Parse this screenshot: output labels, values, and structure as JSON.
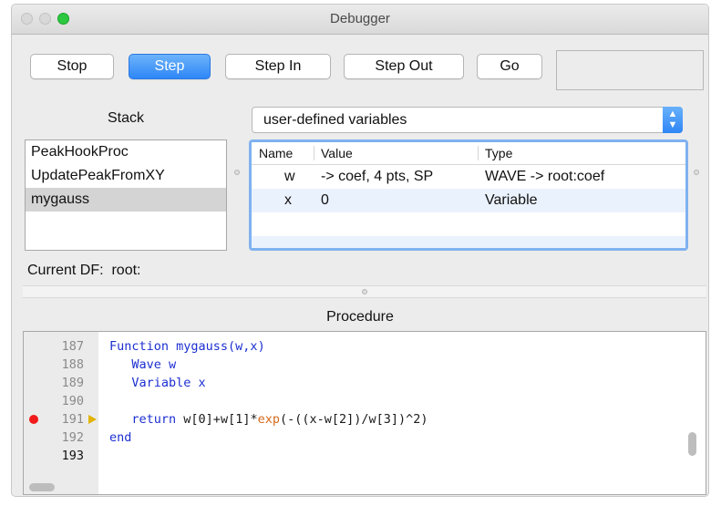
{
  "window": {
    "title": "Debugger"
  },
  "toolbar": {
    "stop_label": "Stop",
    "step_label": "Step",
    "step_in_label": "Step In",
    "step_out_label": "Step Out",
    "go_label": "Go"
  },
  "stack": {
    "label": "Stack",
    "items": [
      "PeakHookProc",
      "UpdatePeakFromXY",
      "mygauss"
    ],
    "selected": "mygauss"
  },
  "variables": {
    "dropdown_value": "user-defined variables",
    "columns": [
      "Name",
      "Value",
      "Type"
    ],
    "rows": [
      {
        "name": "w",
        "value": "-> coef, 4 pts, SP",
        "type": "WAVE -> root:coef"
      },
      {
        "name": "x",
        "value": "0",
        "type": "Variable"
      }
    ]
  },
  "current_df": {
    "label": "Current DF:",
    "value": "root:"
  },
  "procedure": {
    "label": "Procedure",
    "lines": [
      {
        "num": "187",
        "parts": [
          {
            "t": "Function",
            "c": "kw"
          },
          {
            "t": " mygauss(w,x)",
            "c": "kw"
          }
        ]
      },
      {
        "num": "188",
        "parts": [
          {
            "t": "   Wave w",
            "c": "kw"
          }
        ]
      },
      {
        "num": "189",
        "parts": [
          {
            "t": "   Variable x",
            "c": "kw"
          }
        ]
      },
      {
        "num": "190",
        "parts": []
      },
      {
        "num": "191",
        "parts": [
          {
            "t": "   ",
            "c": ""
          },
          {
            "t": "return",
            "c": "kw"
          },
          {
            "t": " w[0]+w[1]*",
            "c": ""
          },
          {
            "t": "exp",
            "c": "fn"
          },
          {
            "t": "(-((x-w[2])/w[3])^2)",
            "c": ""
          }
        ]
      },
      {
        "num": "192",
        "parts": [
          {
            "t": "end",
            "c": "kw"
          }
        ]
      },
      {
        "num": "193",
        "parts": []
      }
    ],
    "breakpoint_line": "191",
    "current_line": "191"
  },
  "colors": {
    "accent": "#2e87f7",
    "breakpoint": "#f21a1a",
    "keyword": "#1c2fd1",
    "builtin_function": "#d76a1e"
  }
}
